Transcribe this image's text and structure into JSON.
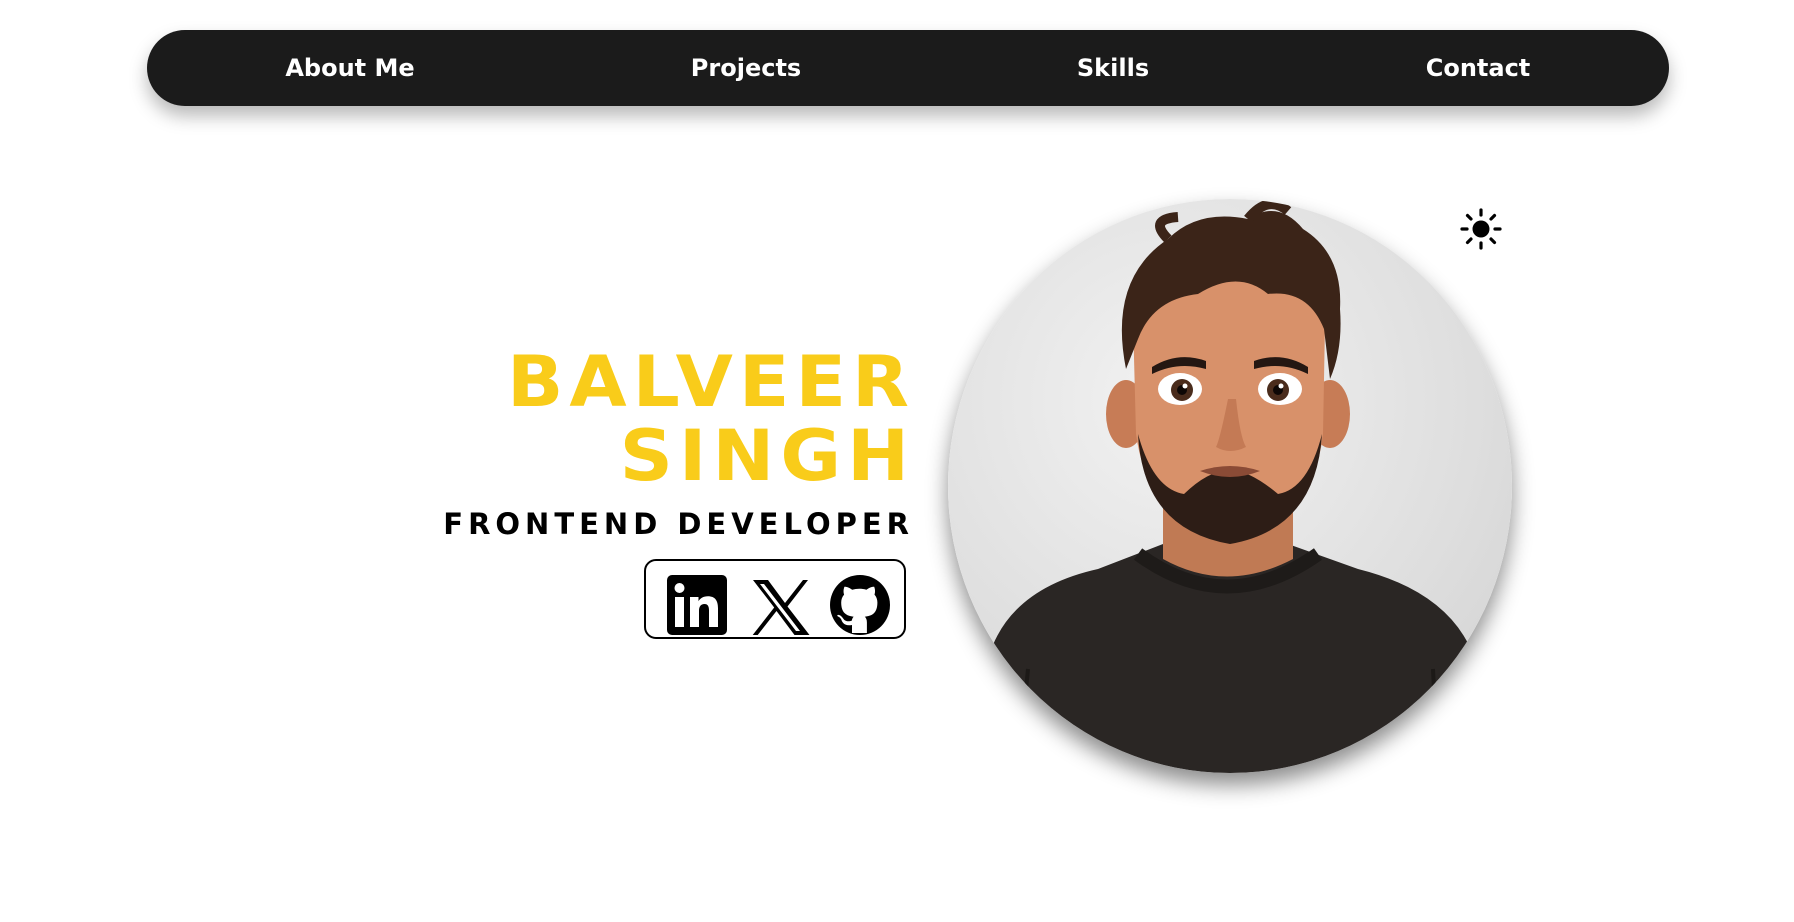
{
  "nav": {
    "items": [
      {
        "label": "About Me"
      },
      {
        "label": "Projects"
      },
      {
        "label": "Skills"
      },
      {
        "label": "Contact"
      }
    ]
  },
  "hero": {
    "first_name": "BALVEER",
    "last_name": "SINGH",
    "role": "FRONTEND DEVELOPER"
  },
  "socials": [
    {
      "icon": "linkedin-icon"
    },
    {
      "icon": "x-icon"
    },
    {
      "icon": "github-icon"
    }
  ],
  "theme": {
    "icon": "sun-icon"
  },
  "colors": {
    "accent": "#f9cc1a",
    "nav_bg": "#1b1b1b",
    "text": "#000000"
  }
}
